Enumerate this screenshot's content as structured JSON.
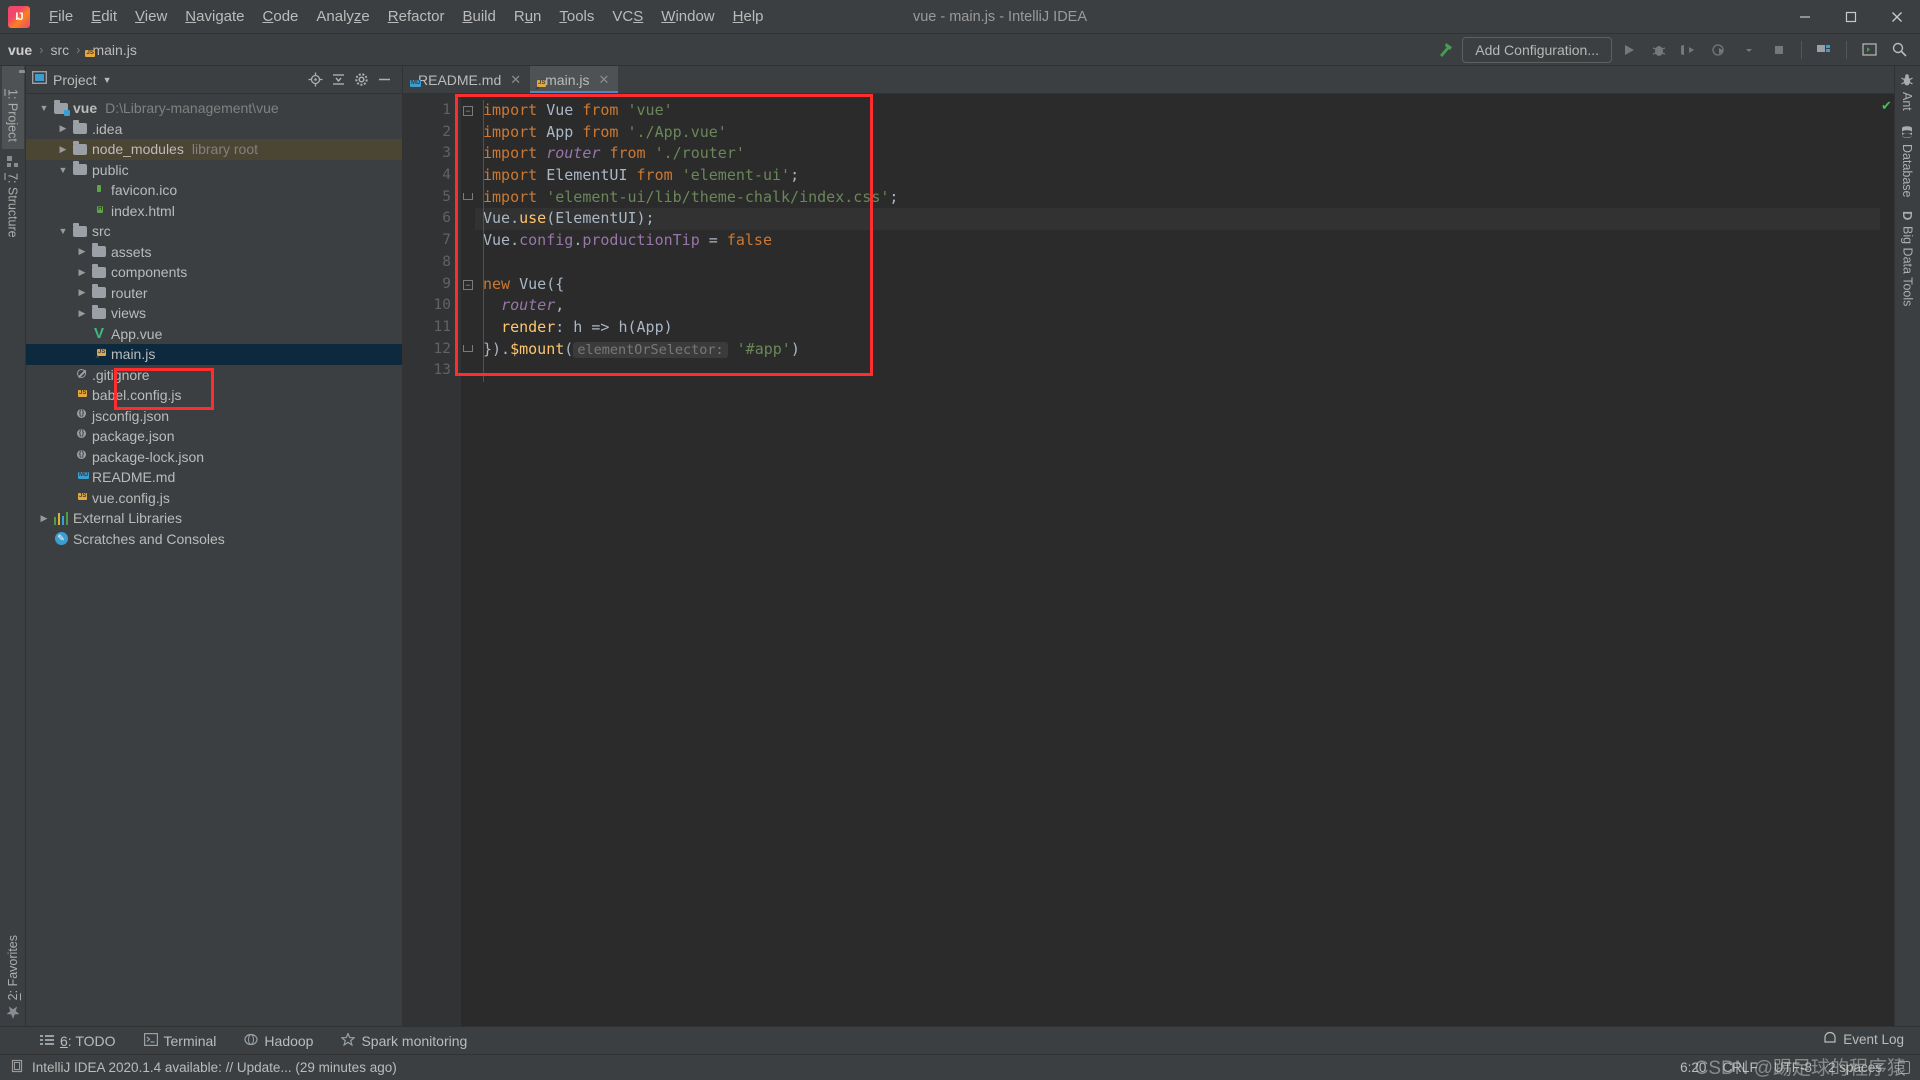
{
  "window": {
    "title": "vue - main.js - IntelliJ IDEA",
    "minimize_label": "—",
    "maximize_label": "❐",
    "close_label": "✕"
  },
  "menu": [
    {
      "pre": "",
      "mn": "F",
      "post": "ile"
    },
    {
      "pre": "",
      "mn": "E",
      "post": "dit"
    },
    {
      "pre": "",
      "mn": "V",
      "post": "iew"
    },
    {
      "pre": "",
      "mn": "N",
      "post": "avigate"
    },
    {
      "pre": "",
      "mn": "C",
      "post": "ode"
    },
    {
      "pre": "Analy",
      "mn": "z",
      "post": "e"
    },
    {
      "pre": "",
      "mn": "R",
      "post": "efactor"
    },
    {
      "pre": "",
      "mn": "B",
      "post": "uild"
    },
    {
      "pre": "R",
      "mn": "u",
      "post": "n"
    },
    {
      "pre": "",
      "mn": "T",
      "post": "ools"
    },
    {
      "pre": "VC",
      "mn": "S",
      "post": ""
    },
    {
      "pre": "",
      "mn": "W",
      "post": "indow"
    },
    {
      "pre": "",
      "mn": "H",
      "post": "elp"
    }
  ],
  "breadcrumb": {
    "items": [
      "vue",
      "src",
      "main.js"
    ],
    "separator": "›"
  },
  "toolbar": {
    "add_configuration": "Add Configuration...",
    "icons": [
      "hammer-icon",
      "run-icon",
      "debug-icon",
      "run-coverage-icon",
      "profile-icon",
      "dropdown-icon",
      "stop-icon",
      "project-structure-icon",
      "terminal-icon",
      "search-everywhere-icon"
    ]
  },
  "left_tool_tabs": [
    {
      "num": "1",
      "label": ": Project",
      "icon": "project-icon",
      "active": true
    },
    {
      "num": "7",
      "label": ": Structure",
      "icon": "structure-icon",
      "active": false
    }
  ],
  "bottom_left_tool_tabs": [
    {
      "num": "2",
      "label": ": Favorites",
      "icon": "star-icon"
    }
  ],
  "right_tool_tabs": [
    {
      "label": "Ant",
      "icon": "ant-icon"
    },
    {
      "label": "Database",
      "icon": "database-icon"
    },
    {
      "label": "Big Data Tools",
      "icon": "bigdata-icon"
    }
  ],
  "project_panel": {
    "title": "Project",
    "caret": "▼",
    "actions": [
      "locate-icon",
      "collapse-all-icon",
      "settings-icon",
      "hide-icon"
    ],
    "tree": [
      {
        "indent": 0,
        "arrow": "▼",
        "icon": "folder-module",
        "label": "vue",
        "bold": true,
        "sub": "D:\\Library-management\\vue",
        "state": "normal"
      },
      {
        "indent": 1,
        "arrow": "▶",
        "icon": "folder",
        "label": ".idea",
        "bold": false,
        "sub": "",
        "state": "normal"
      },
      {
        "indent": 1,
        "arrow": "▶",
        "icon": "folder",
        "label": "node_modules",
        "bold": false,
        "sub": "library root",
        "state": "library"
      },
      {
        "indent": 1,
        "arrow": "▼",
        "icon": "folder",
        "label": "public",
        "bold": false,
        "sub": "",
        "state": "normal"
      },
      {
        "indent": 2,
        "arrow": "",
        "icon": "file-image",
        "label": "favicon.ico",
        "bold": false,
        "sub": "",
        "state": "normal"
      },
      {
        "indent": 2,
        "arrow": "",
        "icon": "file-html",
        "label": "index.html",
        "bold": false,
        "sub": "",
        "state": "normal"
      },
      {
        "indent": 1,
        "arrow": "▼",
        "icon": "folder",
        "label": "src",
        "bold": false,
        "sub": "",
        "state": "normal"
      },
      {
        "indent": 2,
        "arrow": "▶",
        "icon": "folder",
        "label": "assets",
        "bold": false,
        "sub": "",
        "state": "normal"
      },
      {
        "indent": 2,
        "arrow": "▶",
        "icon": "folder",
        "label": "components",
        "bold": false,
        "sub": "",
        "state": "normal"
      },
      {
        "indent": 2,
        "arrow": "▶",
        "icon": "folder",
        "label": "router",
        "bold": false,
        "sub": "",
        "state": "normal"
      },
      {
        "indent": 2,
        "arrow": "▶",
        "icon": "folder",
        "label": "views",
        "bold": false,
        "sub": "",
        "state": "normal"
      },
      {
        "indent": 2,
        "arrow": "",
        "icon": "file-vue",
        "label": "App.vue",
        "bold": false,
        "sub": "",
        "state": "normal"
      },
      {
        "indent": 2,
        "arrow": "",
        "icon": "file-js",
        "label": "main.js",
        "bold": false,
        "sub": "",
        "state": "selected"
      },
      {
        "indent": 1,
        "arrow": "",
        "icon": "file-git",
        "label": ".gitignore",
        "bold": false,
        "sub": "",
        "state": "normal"
      },
      {
        "indent": 1,
        "arrow": "",
        "icon": "file-js",
        "label": "babel.config.js",
        "bold": false,
        "sub": "",
        "state": "normal"
      },
      {
        "indent": 1,
        "arrow": "",
        "icon": "file-json",
        "label": "jsconfig.json",
        "bold": false,
        "sub": "",
        "state": "normal"
      },
      {
        "indent": 1,
        "arrow": "",
        "icon": "file-json",
        "label": "package.json",
        "bold": false,
        "sub": "",
        "state": "normal"
      },
      {
        "indent": 1,
        "arrow": "",
        "icon": "file-json",
        "label": "package-lock.json",
        "bold": false,
        "sub": "",
        "state": "normal"
      },
      {
        "indent": 1,
        "arrow": "",
        "icon": "file-md",
        "label": "README.md",
        "bold": false,
        "sub": "",
        "state": "normal"
      },
      {
        "indent": 1,
        "arrow": "",
        "icon": "file-js",
        "label": "vue.config.js",
        "bold": false,
        "sub": "",
        "state": "normal"
      },
      {
        "indent": 0,
        "arrow": "▶",
        "icon": "libraries",
        "label": "External Libraries",
        "bold": false,
        "sub": "",
        "state": "normal"
      },
      {
        "indent": 0,
        "arrow": "",
        "icon": "scratches",
        "label": "Scratches and Consoles",
        "bold": false,
        "sub": "",
        "state": "normal"
      }
    ]
  },
  "editor": {
    "tabs": [
      {
        "label": "README.md",
        "icon": "file-md",
        "active": false,
        "close": "✕"
      },
      {
        "label": "main.js",
        "icon": "file-js",
        "active": true,
        "close": "✕"
      }
    ],
    "line_numbers": [
      "1",
      "2",
      "3",
      "4",
      "5",
      "6",
      "7",
      "8",
      "9",
      "10",
      "11",
      "12",
      "13"
    ],
    "inspection_status": "ok-check-icon",
    "lines": [
      {
        "n": 1,
        "highlight": false,
        "tokens": [
          {
            "t": "import",
            "c": "kw"
          },
          {
            "t": " ",
            "c": "plain"
          },
          {
            "t": "Vue",
            "c": "id"
          },
          {
            "t": " ",
            "c": "plain"
          },
          {
            "t": "from",
            "c": "kw"
          },
          {
            "t": " ",
            "c": "plain"
          },
          {
            "t": "'vue'",
            "c": "str"
          }
        ]
      },
      {
        "n": 2,
        "highlight": false,
        "tokens": [
          {
            "t": "import",
            "c": "kw"
          },
          {
            "t": " ",
            "c": "plain"
          },
          {
            "t": "App",
            "c": "id"
          },
          {
            "t": " ",
            "c": "plain"
          },
          {
            "t": "from",
            "c": "kw"
          },
          {
            "t": " ",
            "c": "plain"
          },
          {
            "t": "'./App.vue'",
            "c": "str"
          }
        ]
      },
      {
        "n": 3,
        "highlight": false,
        "tokens": [
          {
            "t": "import",
            "c": "kw"
          },
          {
            "t": " ",
            "c": "plain"
          },
          {
            "t": "router",
            "c": "italic"
          },
          {
            "t": " ",
            "c": "plain"
          },
          {
            "t": "from",
            "c": "kw"
          },
          {
            "t": " ",
            "c": "plain"
          },
          {
            "t": "'./router'",
            "c": "str"
          }
        ]
      },
      {
        "n": 4,
        "highlight": false,
        "tokens": [
          {
            "t": "import",
            "c": "kw"
          },
          {
            "t": " ",
            "c": "plain"
          },
          {
            "t": "ElementUI",
            "c": "id"
          },
          {
            "t": " ",
            "c": "plain"
          },
          {
            "t": "from",
            "c": "kw"
          },
          {
            "t": " ",
            "c": "plain"
          },
          {
            "t": "'element-ui'",
            "c": "str"
          },
          {
            "t": ";",
            "c": "id"
          }
        ]
      },
      {
        "n": 5,
        "highlight": false,
        "tokens": [
          {
            "t": "import",
            "c": "kw"
          },
          {
            "t": " ",
            "c": "plain"
          },
          {
            "t": "'element-ui/lib/theme-chalk/index.css'",
            "c": "str"
          },
          {
            "t": ";",
            "c": "id"
          }
        ]
      },
      {
        "n": 6,
        "highlight": true,
        "tokens": [
          {
            "t": "Vue",
            "c": "id"
          },
          {
            "t": ".",
            "c": "id"
          },
          {
            "t": "use",
            "c": "fn"
          },
          {
            "t": "(ElementUI);",
            "c": "id"
          }
        ]
      },
      {
        "n": 7,
        "highlight": false,
        "tokens": [
          {
            "t": "Vue",
            "c": "id"
          },
          {
            "t": ".",
            "c": "id"
          },
          {
            "t": "config",
            "c": "prop"
          },
          {
            "t": ".",
            "c": "id"
          },
          {
            "t": "productionTip",
            "c": "prop"
          },
          {
            "t": " = ",
            "c": "id"
          },
          {
            "t": "false",
            "c": "kw"
          }
        ]
      },
      {
        "n": 8,
        "highlight": false,
        "tokens": []
      },
      {
        "n": 9,
        "highlight": false,
        "tokens": [
          {
            "t": "new",
            "c": "kw"
          },
          {
            "t": " ",
            "c": "plain"
          },
          {
            "t": "Vue({",
            "c": "id"
          }
        ]
      },
      {
        "n": 10,
        "highlight": false,
        "tokens": [
          {
            "t": "  ",
            "c": "plain"
          },
          {
            "t": "router",
            "c": "italic"
          },
          {
            "t": ",",
            "c": "id"
          }
        ]
      },
      {
        "n": 11,
        "highlight": false,
        "tokens": [
          {
            "t": "  ",
            "c": "plain"
          },
          {
            "t": "render",
            "c": "fn"
          },
          {
            "t": ": h => h(App)",
            "c": "id"
          }
        ]
      },
      {
        "n": 12,
        "highlight": false,
        "tokens": [
          {
            "t": "}).",
            "c": "id"
          },
          {
            "t": "$mount",
            "c": "fn"
          },
          {
            "t": "(",
            "c": "id"
          },
          {
            "t": "elementOrSelector:",
            "c": "hint"
          },
          {
            "t": " ",
            "c": "plain"
          },
          {
            "t": "'#app'",
            "c": "str"
          },
          {
            "t": ")",
            "c": "id"
          }
        ]
      },
      {
        "n": 13,
        "highlight": false,
        "tokens": []
      }
    ]
  },
  "annotations": {
    "code_box": "red-highlight-rect-code",
    "tree_box": "red-highlight-rect-mainjs"
  },
  "tool_windows": [
    {
      "num": "6",
      "label": ": TODO",
      "icon": "todo-icon"
    },
    {
      "num": "",
      "label": "Terminal",
      "icon": "terminal-icon"
    },
    {
      "num": "",
      "label": "Hadoop",
      "icon": "hadoop-icon"
    },
    {
      "num": "",
      "label": "Spark monitoring",
      "icon": "spark-icon"
    }
  ],
  "status": {
    "message": "IntelliJ IDEA 2020.1.4 available: // Update... (29 minutes ago)",
    "message_icon": "ide-update-icon",
    "event_log": "Event Log",
    "event_log_icon": "event-log-icon",
    "caret_position": "6:20",
    "line_separator": "CRLF",
    "encoding": "UTF-8",
    "indent": "2 spaces",
    "lock_icon": "lock-icon",
    "watermark": "CSDN @踢足球的程序猿"
  },
  "colors": {
    "accent": "#4a88c7",
    "annotation": "#ff2d2d",
    "selection": "#0d293e",
    "library_row": "#4b4634",
    "editor_bg": "#2b2b2b",
    "panel_bg": "#3c3f41"
  }
}
